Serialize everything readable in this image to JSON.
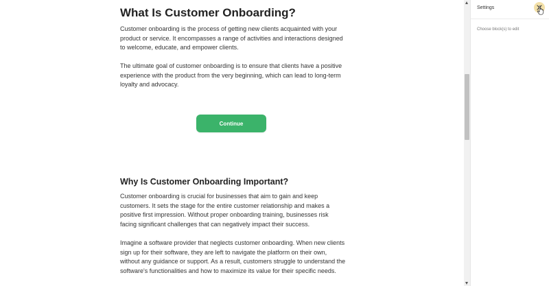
{
  "article": {
    "title": "What Is Customer Onboarding?",
    "intro_paragraph": "Customer onboarding is the process of getting new clients acquainted with your product or service. It encompasses a range of activities and interactions designed to welcome, educate, and empower clients.",
    "goal_paragraph": "The ultimate goal of customer onboarding is to ensure that clients have a positive experience with the product from the very beginning, which can lead to long-term loyalty and advocacy.",
    "continue_label": "Continue",
    "section_title": "Why Is Customer Onboarding Important?",
    "importance_paragraph": "Customer onboarding is crucial for businesses that aim to gain and keep customers. It sets the stage for the entire customer relationship and makes a positive first impression. Without proper onboarding training, businesses risk facing significant challenges that can negatively impact their success.",
    "example_paragraph": "Imagine a software provider that neglects customer onboarding. When new clients sign up for their software, they are left to navigate the platform on their own, without any guidance or support. As a result, customers struggle to understand the software's functionalities and how to maximize its value for their specific needs."
  },
  "settings_panel": {
    "title": "Settings",
    "hint": "Choose block(s) to edit",
    "close_icon": "close-icon"
  },
  "colors": {
    "button": "#3bb36a",
    "close_highlight": "#f3e0a8"
  }
}
